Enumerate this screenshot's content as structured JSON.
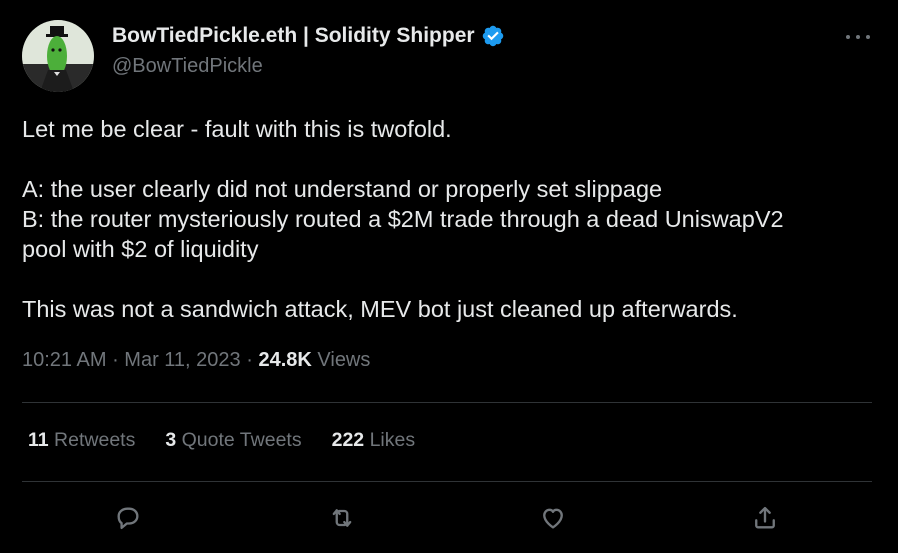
{
  "author": {
    "display_name": "BowTiedPickle.eth | Solidity Shipper",
    "handle": "@BowTiedPickle",
    "avatar_icon": "pickle-avatar-icon",
    "verified_icon": "verified-badge-icon",
    "verified_color": "#1d9bf0"
  },
  "tweet": {
    "lines_p1": [
      "Let me be clear - fault with this is twofold."
    ],
    "lines_p2": [
      "A: the user clearly did not understand or properly set slippage",
      "B: the router mysteriously routed a $2M trade through a dead UniswapV2",
      "pool with $2 of liquidity"
    ],
    "lines_p3": [
      "This was not a sandwich attack, MEV bot just cleaned up afterwards."
    ]
  },
  "meta": {
    "time": "10:21 AM",
    "separator": "·",
    "date": "Mar 11, 2023",
    "views_count": "24.8K",
    "views_label": "Views"
  },
  "stats": {
    "retweets_count": "11",
    "retweets_label": "Retweets",
    "quotes_count": "3",
    "quotes_label": "Quote Tweets",
    "likes_count": "222",
    "likes_label": "Likes"
  },
  "actions": {
    "reply_icon": "reply-icon",
    "retweet_icon": "retweet-icon",
    "like_icon": "heart-icon",
    "share_icon": "share-icon"
  },
  "colors": {
    "background": "#000000",
    "primary_text": "#e7e9ea",
    "secondary_text": "#71767b",
    "divider": "#2f3336"
  }
}
